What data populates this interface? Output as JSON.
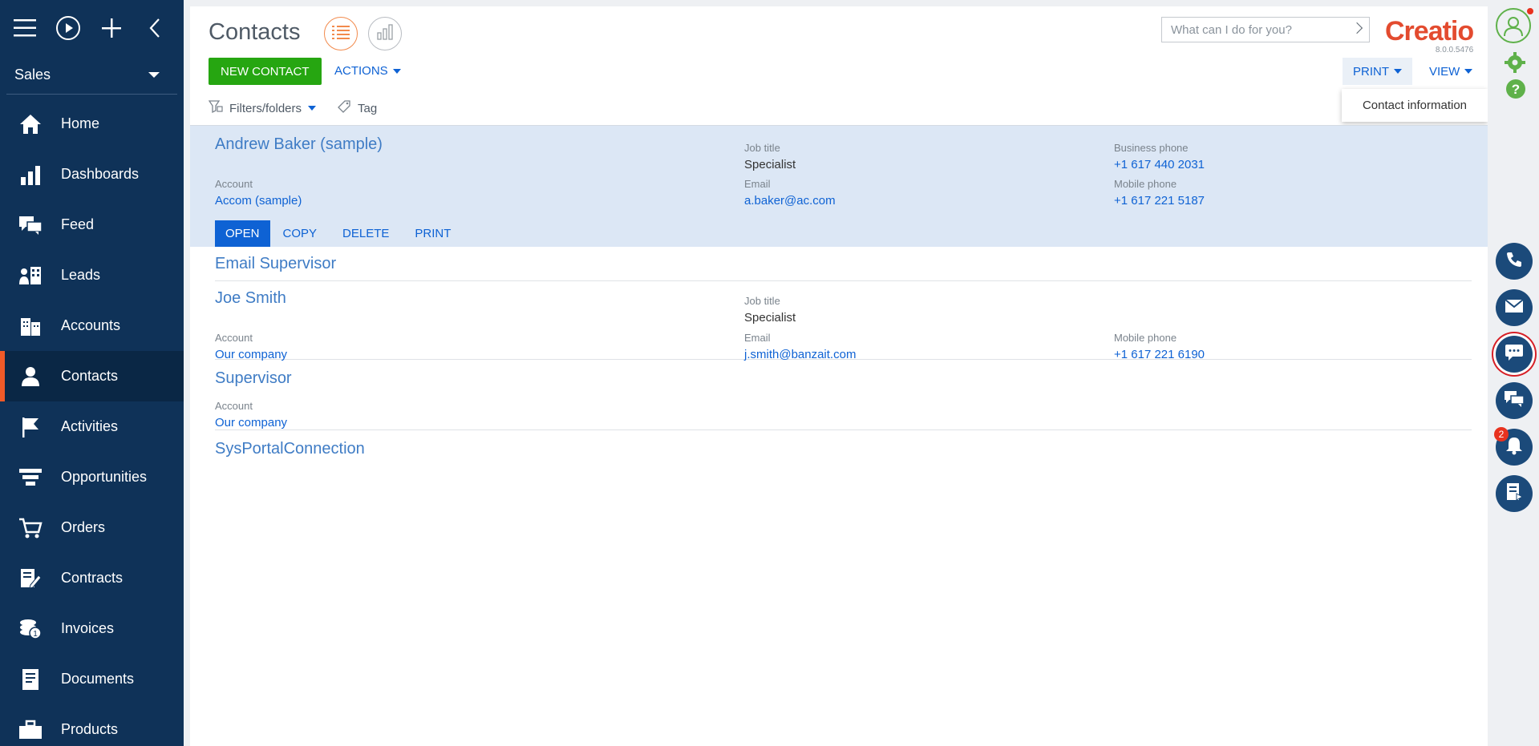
{
  "sidebar": {
    "workspace": "Sales",
    "items": [
      {
        "label": "Home"
      },
      {
        "label": "Dashboards"
      },
      {
        "label": "Feed"
      },
      {
        "label": "Leads"
      },
      {
        "label": "Accounts"
      },
      {
        "label": "Contacts"
      },
      {
        "label": "Activities"
      },
      {
        "label": "Opportunities"
      },
      {
        "label": "Orders"
      },
      {
        "label": "Contracts"
      },
      {
        "label": "Invoices"
      },
      {
        "label": "Documents"
      },
      {
        "label": "Products"
      }
    ],
    "active_item": "Contacts"
  },
  "header": {
    "title": "Contacts",
    "new_button": "NEW CONTACT",
    "actions_button": "ACTIONS",
    "filters": "Filters/folders",
    "tag": "Tag",
    "search_placeholder": "What can I do for you?",
    "logo": "Creatio",
    "version": "8.0.0.5476",
    "print_button": "PRINT",
    "view_button": "VIEW",
    "print_menu": [
      "Contact information"
    ]
  },
  "records": [
    {
      "name": "Andrew Baker (sample)",
      "account_label": "Account",
      "account": "Accom (sample)",
      "job_label": "Job title",
      "job": "Specialist",
      "email_label": "Email",
      "email": "a.baker@ac.com",
      "bphone_label": "Business phone",
      "bphone": "+1 617 440 2031",
      "mphone_label": "Mobile phone",
      "mphone": "+1 617 221 5187",
      "actions": [
        "OPEN",
        "COPY",
        "DELETE",
        "PRINT"
      ]
    },
    {
      "name": "Email Supervisor"
    },
    {
      "name": "Joe Smith",
      "account_label": "Account",
      "account": "Our company",
      "job_label": "Job title",
      "job": "Specialist",
      "email_label": "Email",
      "email": "j.smith@banzait.com",
      "mphone_label": "Mobile phone",
      "mphone": "+1 617 221 6190"
    },
    {
      "name": "Supervisor",
      "account_label": "Account",
      "account": "Our company"
    },
    {
      "name": "SysPortalConnection"
    }
  ],
  "rightbar": {
    "notification_count": "2"
  },
  "colors": {
    "sidebar": "#0f3258",
    "accent": "#f05a28",
    "link": "#0e62d4",
    "new_button": "#26a611",
    "brand": "#e34b2f"
  }
}
